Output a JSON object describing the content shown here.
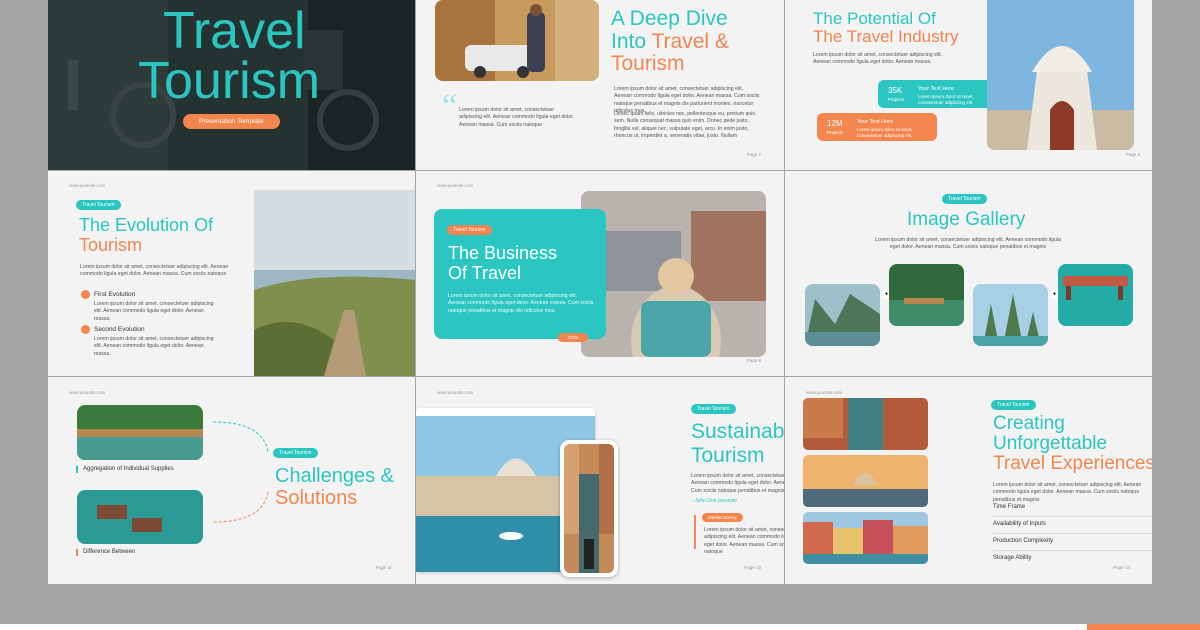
{
  "s1": {
    "title1": "Travel",
    "title2": "Tourism",
    "pill": "Presentation Template"
  },
  "s2": {
    "h1": "A Deep Dive",
    "h2a": "Into ",
    "h2b": "Travel &",
    "h3": "Tourism",
    "quote": "Lorem ipsum dolor sit amet, consectetuer adipiscing elit. Aenean commodo ligula eget dolor. Aenean massa. Cum sociis natoque",
    "p1": "Lorem ipsum dolor sit amet, consectetuer adipiscing elit. Aenean commodo ligula eget dolor. Aenean massa. Cum sociis natoque penatibus et magnis dis parturient montes, nascetur ridiculus mus.",
    "p2": "Donec quam felis, ultricies nec, pellentesque eu, pretium quis, sem. Nulla consequat massa quis enim. Donec pede justo, fringilla vel, aliquet nec, vulputate eget, arcu. In enim justo, rhoncus ut, imperdiet a, venenatis vitae, justo. Nullam",
    "page": "Page 2"
  },
  "s3": {
    "h1": "The Potential Of",
    "h2": "The Travel Industry",
    "p": "Lorem ipsum dolor sit amet, consectetuer adipiscing elit. Aenean commodo ligula eget dolor. Aenean massa.",
    "stat1_value": "35K",
    "stat1_label": "Projects",
    "stat1_title": "Your Text Here",
    "stat1_text": "Lorem ipsum dolor sit amet, consectetuer adipiscing elit.",
    "stat2_value": "12M",
    "stat2_label": "Projects",
    "stat2_title": "Your Text Here",
    "stat2_text": "Lorem ipsum dolor sit amet, consectetuer adipiscing elit.",
    "page": "Page 3"
  },
  "s4": {
    "url": "www.yoursite.com",
    "pill": "Travel Tourism",
    "h1": "The Evolution Of",
    "h2": "Tourism",
    "p": "Lorem ipsum dolor sit amet, consectetuer adipiscing elit. Aenean commodo ligula eget dolor. Aenean massa. Cum sociis natoque",
    "e1_title": "First Evolution",
    "e1_text": "Lorem ipsum dolor sit amet, consectetuer adipiscing elit. Aenean commodo ligula eget dolor. Aenean massa.",
    "e2_title": "Second Evolution",
    "e2_text": "Lorem ipsum dolor sit amet, consectetuer adipiscing elit. Aenean commodo ligula eget dolor. Aenean massa."
  },
  "s5": {
    "url": "www.yoursite.com",
    "pill": "Travel Tourism",
    "h1": "The Business",
    "h2": "Of Travel",
    "p": "Lorem ipsum dolor sit amet, consectetuer adipiscing elit. Aenean commodo ligula eget dolor. Aenean massa. Cum sociis natoque penatibus et magnis dis ridiculus mus.",
    "badge": "2025",
    "page": "Page 6"
  },
  "s6": {
    "pill": "Travel Tourism",
    "h": "Image Gallery",
    "p": "Lorem ipsum dolor sit amet, consectetuer adipiscing elit. Aenean commodo ligula eget dolor. Aenean massa. Cum sociis natoque penatibus et magnis"
  },
  "s7": {
    "url": "www.yoursite.com",
    "pill": "Travel Tourism",
    "h1": "Challenges &",
    "h2": "Solutions",
    "c1": "Aggregation of Individual Supplies",
    "c2": "Difference Between",
    "page": "Page 11"
  },
  "s8": {
    "url": "www.yoursite.com",
    "pill": "Travel Tourism",
    "h1": "Sustainable",
    "h2": "Tourism",
    "p": "Lorem ipsum dolor sit amet, consectetuer adipiscing elit. Aenean commodo ligula eget dolor. Aenean massa. Cum sociis natoque penatibus et magnis",
    "author": "- John Doe presents",
    "tag": "Market Survey",
    "q": "Lorem ipsum dolor sit amet, consectetuer adipiscing elit. Aenean commodo ligula eget dolor. Aenean massa. Cum sociis natoque",
    "page": "Page 13"
  },
  "s9": {
    "url": "www.yoursite.com",
    "pill": "Travel Tourism",
    "h1": "Creating",
    "h2": "Unforgettable",
    "h3": "Travel Experiences",
    "p": "Lorem ipsum dolor sit amet, consectetuer adipiscing elit. Aenean commodo ligula eget dolor. Aenean massa. Cum sociis natoque penatibus et magnis",
    "items": [
      "Time Frame",
      "Availability of Inputs",
      "Production Complexity",
      "Storage Ability"
    ],
    "page": "Page 14"
  },
  "colors": {
    "teal": "#2bc6c1",
    "orange": "#f3854f",
    "bg": "#a5a5a5"
  }
}
